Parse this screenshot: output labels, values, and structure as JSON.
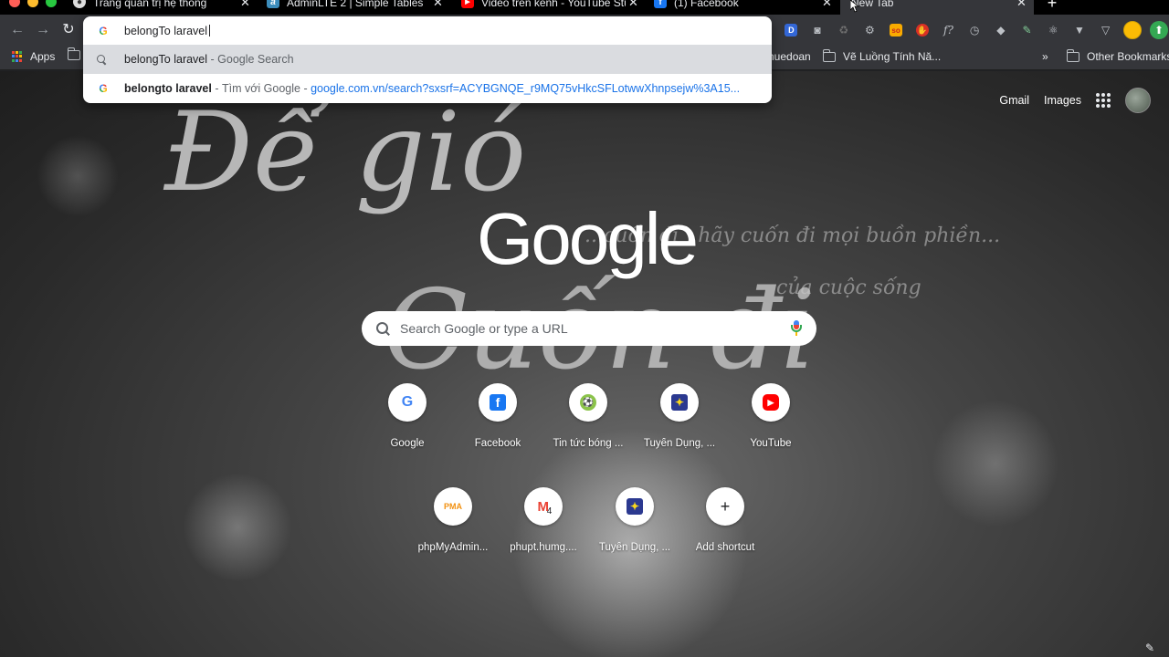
{
  "tabs": [
    {
      "title": "Trang quản trị hệ thống",
      "favicon": "generic-icon"
    },
    {
      "title": "AdminLTE 2 | Simple Tables",
      "favicon": "adminlte-icon"
    },
    {
      "title": "Video trên kênh - YouTube Stu",
      "favicon": "youtube-icon"
    },
    {
      "title": "(1) Facebook",
      "favicon": "facebook-icon"
    },
    {
      "title": "New Tab",
      "favicon": "none",
      "active": true
    }
  ],
  "new_tab_symbol": "+",
  "close_symbol": "✕",
  "bookmarks": {
    "apps": "Apps",
    "item_1": "huedoan",
    "item_2": "Vẽ Luồng Tính Nă...",
    "overflow": "»",
    "other": "Other Bookmarks"
  },
  "omnibox": {
    "typed": "belongTo laravel",
    "suggestions": [
      {
        "main": "belongTo laravel",
        "sep": " - ",
        "sub": "Google Search"
      },
      {
        "main": "belongto laravel",
        "sep": " - ",
        "sub": "Tìm với Google - ",
        "url": "google.com.vn/search?sxsrf=ACYBGNQE_r9MQ75vHkcSFLotwwXhnpsejw%3A15..."
      }
    ]
  },
  "ntp": {
    "links": {
      "gmail": "Gmail",
      "images": "Images"
    },
    "logo": "Google",
    "search_placeholder": "Search Google or type a URL",
    "background_text": {
      "line1": "Để gió",
      "line2": "Cuốn đi",
      "line3": "...cuốn đi , hãy cuốn đi mọi buồn phiền...",
      "line4": "của cuộc sống"
    },
    "shortcuts_row1": [
      {
        "label": "Google",
        "icon": "google-icon"
      },
      {
        "label": "Facebook",
        "icon": "facebook-icon"
      },
      {
        "label": "Tin tức bóng ...",
        "icon": "football-news-icon"
      },
      {
        "label": "Tuyển Dụng, ...",
        "icon": "recruitment-icon"
      },
      {
        "label": "YouTube",
        "icon": "youtube-icon"
      }
    ],
    "shortcuts_row2": [
      {
        "label": "phpMyAdmin...",
        "icon": "phpmyadmin-icon"
      },
      {
        "label": "phupt.humg....",
        "icon": "gmail-icon",
        "badge": "4"
      },
      {
        "label": "Tuyển Dụng, ...",
        "icon": "recruitment-icon"
      },
      {
        "label": "Add shortcut",
        "icon": "plus-icon",
        "symbol": "+"
      }
    ]
  },
  "colors": {
    "chrome_dark": "#35363a",
    "tabstrip": "#000000",
    "google_blue": "#4285f4",
    "google_red": "#ea4335",
    "google_yellow": "#fbbc04",
    "google_green": "#34a853",
    "link_blue": "#1a73e8"
  }
}
